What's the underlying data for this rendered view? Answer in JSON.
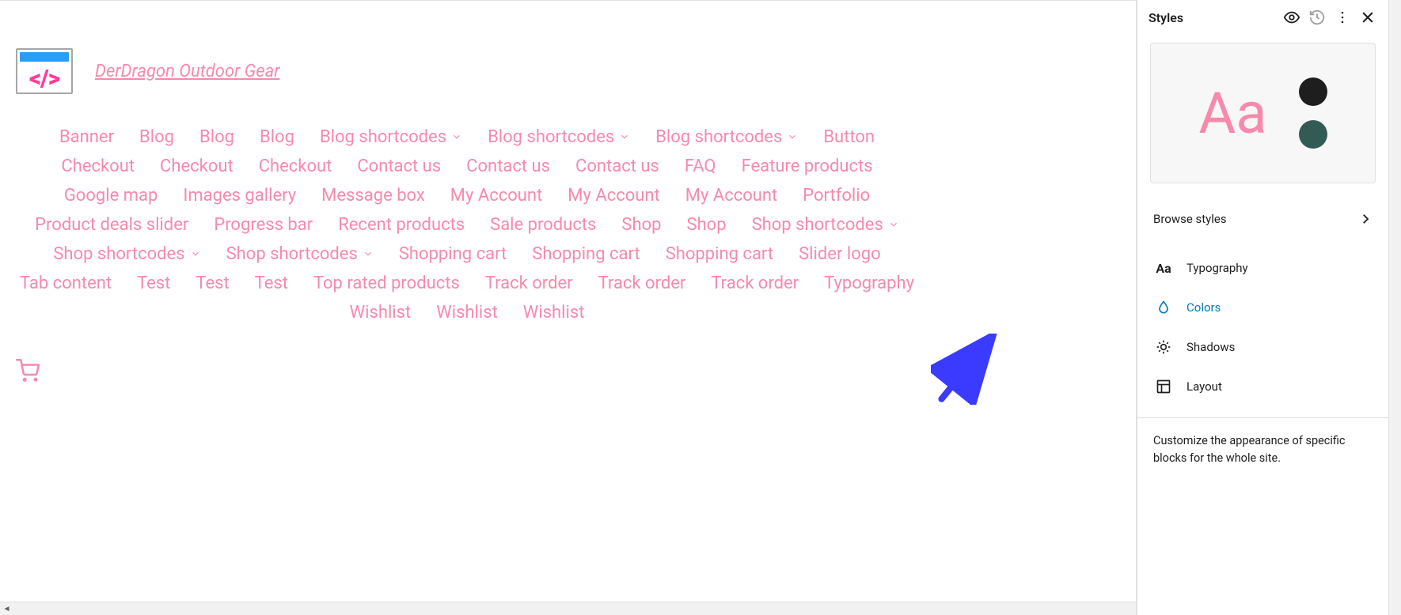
{
  "site": {
    "title": "DerDragon Outdoor Gear"
  },
  "nav": {
    "items": [
      {
        "label": "Banner",
        "dropdown": false
      },
      {
        "label": "Blog",
        "dropdown": false
      },
      {
        "label": "Blog",
        "dropdown": false
      },
      {
        "label": "Blog",
        "dropdown": false
      },
      {
        "label": "Blog shortcodes",
        "dropdown": true
      },
      {
        "label": "Blog shortcodes",
        "dropdown": true
      },
      {
        "label": "Blog shortcodes",
        "dropdown": true
      },
      {
        "label": "Button",
        "dropdown": false
      },
      {
        "label": "Checkout",
        "dropdown": false
      },
      {
        "label": "Checkout",
        "dropdown": false
      },
      {
        "label": "Checkout",
        "dropdown": false
      },
      {
        "label": "Contact us",
        "dropdown": false
      },
      {
        "label": "Contact us",
        "dropdown": false
      },
      {
        "label": "Contact us",
        "dropdown": false
      },
      {
        "label": "FAQ",
        "dropdown": false
      },
      {
        "label": "Feature products",
        "dropdown": false
      },
      {
        "label": "Google map",
        "dropdown": false
      },
      {
        "label": "Images gallery",
        "dropdown": false
      },
      {
        "label": "Message box",
        "dropdown": false
      },
      {
        "label": "My Account",
        "dropdown": false
      },
      {
        "label": "My Account",
        "dropdown": false
      },
      {
        "label": "My Account",
        "dropdown": false
      },
      {
        "label": "Portfolio",
        "dropdown": false
      },
      {
        "label": "Product deals slider",
        "dropdown": false
      },
      {
        "label": "Progress bar",
        "dropdown": false
      },
      {
        "label": "Recent products",
        "dropdown": false
      },
      {
        "label": "Sale products",
        "dropdown": false
      },
      {
        "label": "Shop",
        "dropdown": false
      },
      {
        "label": "Shop",
        "dropdown": false
      },
      {
        "label": "Shop shortcodes",
        "dropdown": true
      },
      {
        "label": "Shop shortcodes",
        "dropdown": true
      },
      {
        "label": "Shop shortcodes",
        "dropdown": true
      },
      {
        "label": "Shopping cart",
        "dropdown": false
      },
      {
        "label": "Shopping cart",
        "dropdown": false
      },
      {
        "label": "Shopping cart",
        "dropdown": false
      },
      {
        "label": "Slider logo",
        "dropdown": false
      },
      {
        "label": "Tab content",
        "dropdown": false
      },
      {
        "label": "Test",
        "dropdown": false
      },
      {
        "label": "Test",
        "dropdown": false
      },
      {
        "label": "Test",
        "dropdown": false
      },
      {
        "label": "Top rated products",
        "dropdown": false
      },
      {
        "label": "Track order",
        "dropdown": false
      },
      {
        "label": "Track order",
        "dropdown": false
      },
      {
        "label": "Track order",
        "dropdown": false
      },
      {
        "label": "Typography",
        "dropdown": false
      },
      {
        "label": "Wishlist",
        "dropdown": false
      },
      {
        "label": "Wishlist",
        "dropdown": false
      },
      {
        "label": "Wishlist",
        "dropdown": false
      }
    ]
  },
  "sidebar": {
    "title": "Styles",
    "preview_text": "Aa",
    "swatches": {
      "primary": "#1e1e1e",
      "secondary": "#335b56"
    },
    "browse_label": "Browse styles",
    "options": [
      {
        "key": "typography",
        "label": "Typography",
        "active": false
      },
      {
        "key": "colors",
        "label": "Colors",
        "active": true
      },
      {
        "key": "shadows",
        "label": "Shadows",
        "active": false
      },
      {
        "key": "layout",
        "label": "Layout",
        "active": false
      }
    ],
    "footer_text": "Customize the appearance of specific blocks for the whole site."
  }
}
